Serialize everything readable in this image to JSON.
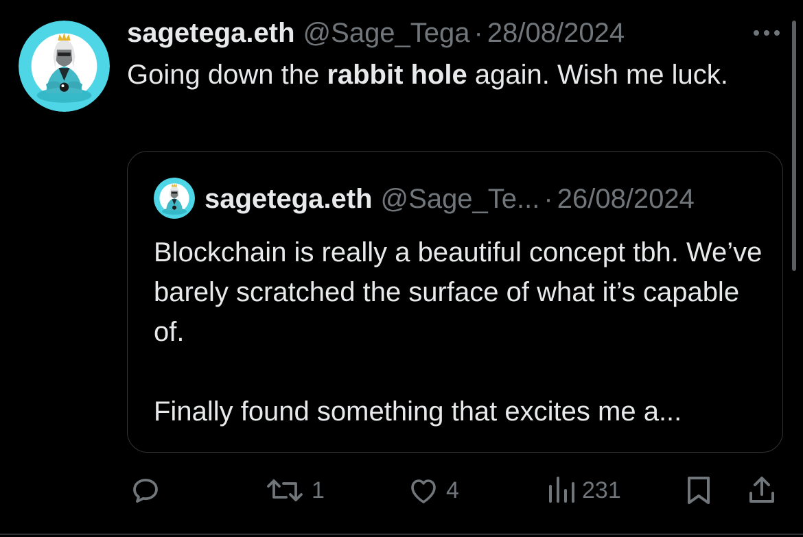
{
  "tweet": {
    "author_name": "sagetega.eth",
    "handle": "@Sage_Tega",
    "separator": "·",
    "date": "28/08/2024",
    "text_before": "Going down the ",
    "text_bold": "rabbit hole",
    "text_after": " again. Wish me luck."
  },
  "quoted": {
    "author_name": "sagetega.eth",
    "handle": "@Sage_Te...",
    "separator": "·",
    "date": "26/08/2024",
    "paragraph_1": "Blockchain is really a beautiful concept tbh. We’ve barely scratched the surface of what it’s capable of.",
    "paragraph_2": "Finally found something that excites me a..."
  },
  "actions": {
    "reply_icon": "reply-icon",
    "retweet_icon": "retweet-icon",
    "retweet_count": "1",
    "like_icon": "heart-icon",
    "like_count": "4",
    "views_icon": "views-icon",
    "views_count": "231",
    "bookmark_icon": "bookmark-icon",
    "share_icon": "share-icon"
  },
  "colors": {
    "background": "#000000",
    "text_primary": "#e7e9ea",
    "text_secondary": "#71767b",
    "border": "#2f3336",
    "avatar_bg": "#4fd6e6"
  }
}
